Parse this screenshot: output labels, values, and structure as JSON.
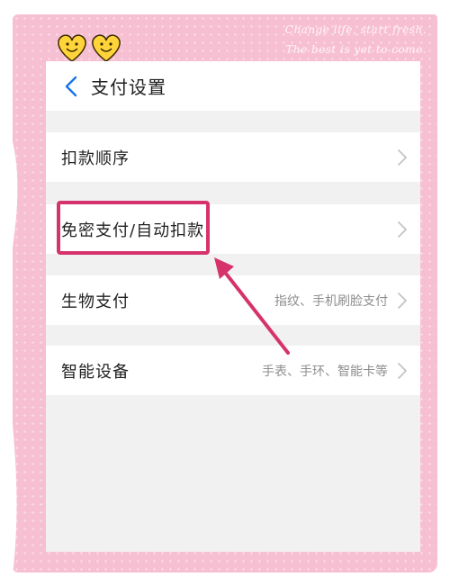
{
  "decor": {
    "slogan_line1": "Change life, start fresh.",
    "slogan_line2": "The best is yet to come.",
    "frame_color": "#f7bfd2",
    "annotation_color": "#d6336c"
  },
  "header": {
    "back_icon": "chevron-left-icon",
    "title": "支付设置"
  },
  "settings": [
    {
      "label": "扣款顺序",
      "value": "",
      "icon": "chevron-right-icon"
    },
    {
      "label": "免密支付/自动扣款",
      "value": "",
      "icon": "chevron-right-icon",
      "highlighted": true
    },
    {
      "label": "生物支付",
      "value": "指纹、手机刷脸支付",
      "icon": "chevron-right-icon"
    },
    {
      "label": "智能设备",
      "value": "手表、手环、智能卡等",
      "icon": "chevron-right-icon"
    }
  ],
  "colors": {
    "accent": "#1a73e8",
    "background": "#f1f1f2",
    "value_text": "#8e8e8e"
  }
}
